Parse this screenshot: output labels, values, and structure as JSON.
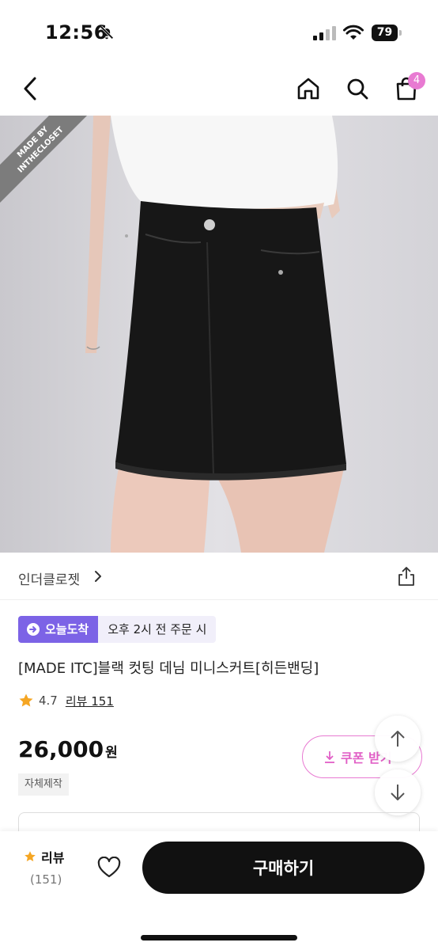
{
  "status_bar": {
    "time": "12:56",
    "battery": "79"
  },
  "nav": {
    "cart_count": "4"
  },
  "product_image": {
    "ribbon_line1": "MADE BY",
    "ribbon_line2": "INTHECLOSET"
  },
  "brand": {
    "name": "인더클로젯"
  },
  "delivery": {
    "tag": "오늘도착",
    "note": "오후 2시 전 주문 시"
  },
  "product": {
    "title": "[MADE ITC]블랙 컷팅 데님 미니스커트[히든밴딩]",
    "rating": "4.7",
    "review_link": "리뷰 151",
    "price": "26,000",
    "price_unit": "원",
    "tag": "자체제작",
    "coupon_label": "쿠폰 받기"
  },
  "bottom_bar": {
    "review_label": "리뷰",
    "review_count": "(151)",
    "buy_label": "구매하기"
  },
  "colors": {
    "accent": "#7c63e6",
    "pink": "#e87ad2",
    "star": "#f5a623"
  },
  "icons": [
    "bell-off-icon",
    "signal-icon",
    "wifi-icon",
    "back-icon",
    "home-icon",
    "search-icon",
    "cart-icon",
    "chevron-right-icon",
    "share-icon",
    "delivery-icon",
    "star-icon",
    "download-icon",
    "arrow-up-icon",
    "arrow-down-icon",
    "heart-icon"
  ]
}
